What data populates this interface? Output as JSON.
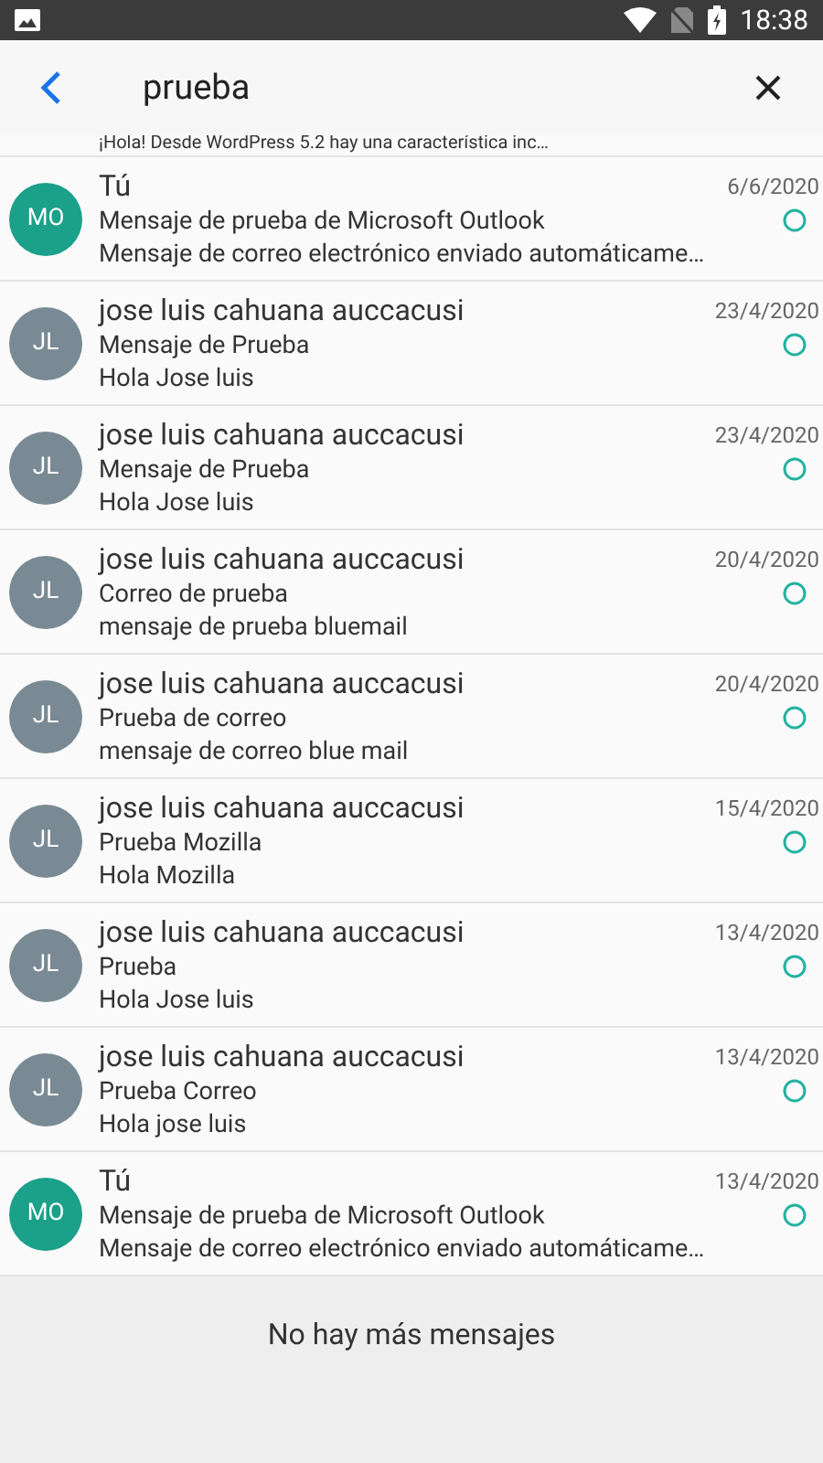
{
  "status_bar": {
    "time": "18:38"
  },
  "search": {
    "value": "prueba"
  },
  "partial_preview": "¡Hola! Desde WordPress 5.2 hay una característica inc…",
  "messages": [
    {
      "initials": "MO",
      "color": "#1ba08a",
      "sender": "Tú",
      "date": "6/6/2020",
      "subject": "Mensaje de prueba de Microsoft Outlook",
      "preview": "Mensaje de correo electrónico enviado automáticame…"
    },
    {
      "initials": "JL",
      "color": "#798a94",
      "sender": "jose luis cahuana auccacusi",
      "date": "23/4/2020",
      "subject": "Mensaje de Prueba",
      "preview": "Hola Jose luis"
    },
    {
      "initials": "JL",
      "color": "#798a94",
      "sender": "jose luis cahuana auccacusi",
      "date": "23/4/2020",
      "subject": "Mensaje de Prueba",
      "preview": "Hola Jose luis"
    },
    {
      "initials": "JL",
      "color": "#798a94",
      "sender": "jose luis cahuana auccacusi",
      "date": "20/4/2020",
      "subject": "Correo de prueba",
      "preview": "mensaje de prueba bluemail"
    },
    {
      "initials": "JL",
      "color": "#798a94",
      "sender": "jose luis cahuana auccacusi",
      "date": "20/4/2020",
      "subject": "Prueba de correo",
      "preview": "mensaje de correo blue mail"
    },
    {
      "initials": "JL",
      "color": "#798a94",
      "sender": "jose luis cahuana auccacusi",
      "date": "15/4/2020",
      "subject": "Prueba Mozilla",
      "preview": "Hola Mozilla"
    },
    {
      "initials": "JL",
      "color": "#798a94",
      "sender": "jose luis cahuana auccacusi",
      "date": "13/4/2020",
      "subject": "Prueba",
      "preview": "Hola Jose luis"
    },
    {
      "initials": "JL",
      "color": "#798a94",
      "sender": "jose luis cahuana auccacusi",
      "date": "13/4/2020",
      "subject": "Prueba Correo",
      "preview": "Hola jose luis"
    },
    {
      "initials": "MO",
      "color": "#1ba08a",
      "sender": "Tú",
      "date": "13/4/2020",
      "subject": "Mensaje de prueba de Microsoft Outlook",
      "preview": "Mensaje de correo electrónico enviado automáticame…"
    }
  ],
  "footer": "No hay más mensajes"
}
